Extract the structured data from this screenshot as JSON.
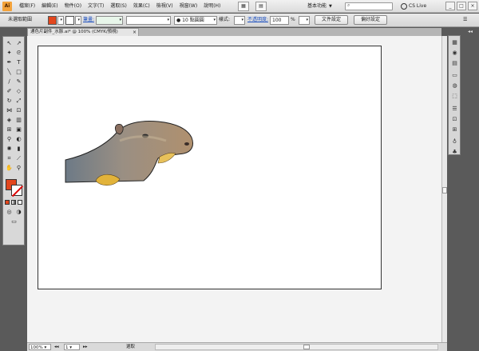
{
  "app": {
    "logo": "Ai"
  },
  "menu": [
    "檔案(F)",
    "編輯(E)",
    "物件(O)",
    "文字(T)",
    "選取(S)",
    "效果(C)",
    "檢視(V)",
    "視窗(W)",
    "說明(H)"
  ],
  "workspace": {
    "label": "基本功能",
    "icon": "chevron-down-icon"
  },
  "search": {
    "icon": "search-icon"
  },
  "cs_live": "CS Live",
  "window_buttons": [
    "_",
    "□",
    "×"
  ],
  "control_bar": {
    "selection_label": "未選取範圍",
    "stroke_label": "筆畫:",
    "brush_size": "10 點圓圓",
    "style_label": "樣式:",
    "opacity_label": "不透明度:",
    "opacity_value": "100",
    "opacity_unit": "%",
    "doc_setup_button": "文件設定",
    "preferences_button": "偏好設定"
  },
  "document": {
    "tab_title": "通色片副件_水豚.ai* @ 100% (CMYK/預視)",
    "close_icon": "close-icon"
  },
  "status_bar": {
    "zoom": "100%",
    "artboard_number": "1",
    "tool_label": "選取"
  },
  "colors": {
    "fill": "#e2461d",
    "stroke": "#ffffff",
    "link": "#1b4fbf",
    "ui_dark": "#5a5a5a"
  },
  "artwork": {
    "subject": "capybara-image"
  }
}
